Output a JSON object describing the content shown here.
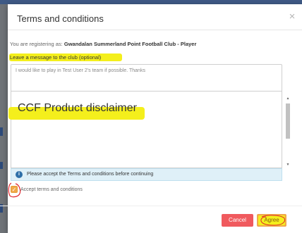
{
  "modal": {
    "title": "Terms and conditions",
    "close_symbol": "×"
  },
  "registration": {
    "prefix": "You are registering as:",
    "club_and_role": "Gwandalan Summerland Point Football Club - Player"
  },
  "message": {
    "label": "Leave a message to the club (optional)",
    "value": "I would like to play in Test User 2's team if possible. Thanks"
  },
  "disclaimer": {
    "heading": "CCF Product disclaimer",
    "scroll_up": "▲",
    "scroll_down": "▼"
  },
  "alert": {
    "icon": "i",
    "text": "Please accept the Terms and conditions before continuing"
  },
  "accept": {
    "label": "Accept terms and conditions",
    "checked": true,
    "check_symbol": "✓"
  },
  "buttons": {
    "cancel": "Cancel",
    "agree": "Agree"
  },
  "colors": {
    "highlight": "#f4ef1c",
    "cancel": "#f05a5e",
    "agree": "#f0a94a",
    "info_bg": "#dff0f8",
    "annotation_red": "#e0262d"
  }
}
